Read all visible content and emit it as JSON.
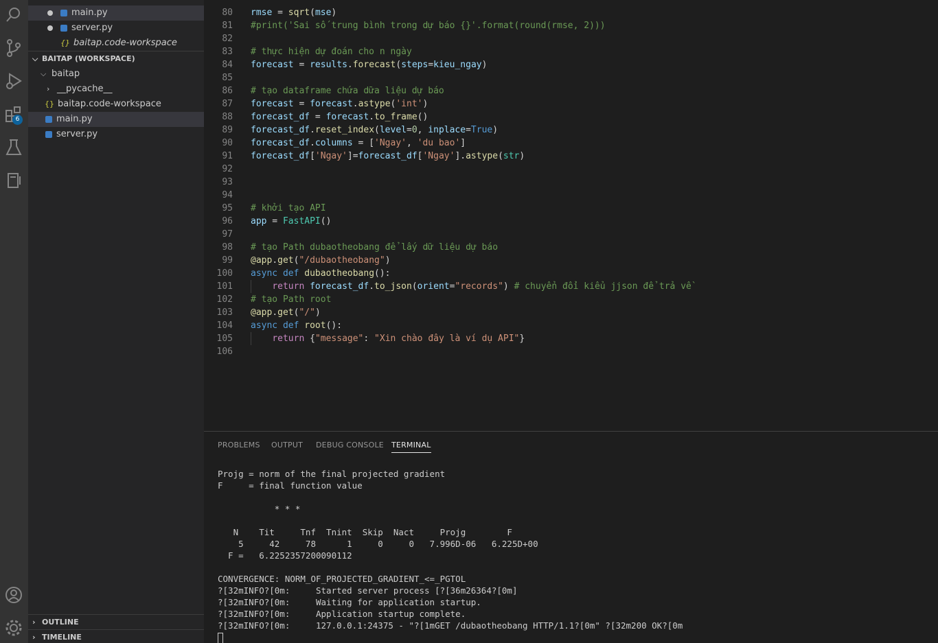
{
  "sidebar": {
    "open_editors": [
      {
        "label": "main.py",
        "type": "py"
      },
      {
        "label": "server.py",
        "type": "py"
      },
      {
        "label": "baitap.code-workspace",
        "type": "json"
      }
    ],
    "workspace_title": "BAITAP (WORKSPACE)",
    "tree": [
      {
        "label": "baitap",
        "type": "folder-open"
      },
      {
        "label": "__pycache__",
        "type": "folder"
      },
      {
        "label": "baitap.code-workspace",
        "type": "json"
      },
      {
        "label": "main.py",
        "type": "py"
      },
      {
        "label": "server.py",
        "type": "py"
      }
    ],
    "outline": "OUTLINE",
    "timeline": "TIMELINE"
  },
  "activity": {
    "extensions_badge": "6"
  },
  "editor": {
    "lines": [
      {
        "n": "80"
      },
      {
        "n": "81"
      },
      {
        "n": "82"
      },
      {
        "n": "83"
      },
      {
        "n": "84"
      },
      {
        "n": "85"
      },
      {
        "n": "86"
      },
      {
        "n": "87"
      },
      {
        "n": "88"
      },
      {
        "n": "89"
      },
      {
        "n": "90"
      },
      {
        "n": "91"
      },
      {
        "n": "92"
      },
      {
        "n": "93"
      },
      {
        "n": "94"
      },
      {
        "n": "95"
      },
      {
        "n": "96"
      },
      {
        "n": "97"
      },
      {
        "n": "98"
      },
      {
        "n": "99"
      },
      {
        "n": "100"
      },
      {
        "n": "101"
      },
      {
        "n": "102"
      },
      {
        "n": "103"
      },
      {
        "n": "104"
      },
      {
        "n": "105"
      },
      {
        "n": "106"
      }
    ],
    "code": {
      "l80": [
        "rmse",
        " = ",
        "sqrt",
        "(",
        "mse",
        ")"
      ],
      "l81": "#print('Sai số trung bình trong dự báo {}'.format(round(rmse, 2)))",
      "l83": "# thực hiện dự đoán cho n ngày",
      "l84": [
        "forecast",
        " = ",
        "results",
        ".",
        "forecast",
        "(",
        "steps",
        "=",
        "kieu_ngay",
        ")"
      ],
      "l86": "# tạo dataframe chứa dữa liệu dự báo",
      "l87": [
        "forecast",
        " = ",
        "forecast",
        ".",
        "astype",
        "(",
        "'int'",
        ")"
      ],
      "l88": [
        "forecast_df",
        " = ",
        "forecast",
        ".",
        "to_frame",
        "()"
      ],
      "l89": [
        "forecast_df",
        ".",
        "reset_index",
        "(",
        "level",
        "=",
        "0",
        ", ",
        "inplace",
        "=",
        "True",
        ")"
      ],
      "l90": [
        "forecast_df",
        ".",
        "columns",
        " = ",
        "[",
        "'Ngay'",
        ", ",
        "'du bao'",
        "]"
      ],
      "l91": [
        "forecast_df",
        "[",
        "'Ngay'",
        "]=",
        "forecast_df",
        "[",
        "'Ngay'",
        "].",
        "astype",
        "(",
        "str",
        ")"
      ],
      "l95": "# khởi tạo API",
      "l96": [
        "app",
        " = ",
        "FastAPI",
        "()"
      ],
      "l98": "# tạo Path dubaotheobang để lấy dữ liệu dự báo",
      "l99": [
        "@",
        "app",
        ".",
        "get",
        "(",
        "\"/dubaotheobang\"",
        ")"
      ],
      "l100": [
        "async",
        " ",
        "def",
        " ",
        "dubaotheobang",
        "():"
      ],
      "l101": [
        "    ",
        "return",
        " ",
        "forecast_df",
        ".",
        "to_json",
        "(",
        "orient",
        "=",
        "\"records\"",
        ") ",
        "# chuyển đổi kiểu jjson để trả về"
      ],
      "l102": "# tạo Path root",
      "l103": [
        "@",
        "app",
        ".",
        "get",
        "(",
        "\"/\"",
        ")"
      ],
      "l104": [
        "async",
        " ",
        "def",
        " ",
        "root",
        "():"
      ],
      "l105": [
        "    ",
        "return",
        " {",
        "\"message\"",
        ": ",
        "\"Xin chào đây là ví dụ API\"",
        "}"
      ]
    }
  },
  "panel": {
    "tabs": [
      "PROBLEMS",
      "OUTPUT",
      "DEBUG CONSOLE",
      "TERMINAL"
    ],
    "active_tab": "TERMINAL",
    "terminal_lines": [
      "Projg = norm of the final projected gradient",
      "F     = final function value",
      "",
      "           * * *",
      "",
      "   N    Tit     Tnf  Tnint  Skip  Nact     Projg        F",
      "    5     42     78      1     0     0   7.996D-06   6.225D+00",
      "  F =   6.2252357200090112",
      "",
      "CONVERGENCE: NORM_OF_PROJECTED_GRADIENT_<=_PGTOL",
      "?[32mINFO?[0m:     Started server process [?[36m26364?[0m]",
      "?[32mINFO?[0m:     Waiting for application startup.",
      "?[32mINFO?[0m:     Application startup complete.",
      "?[32mINFO?[0m:     127.0.0.1:24375 - \"?[1mGET /dubaotheobang HTTP/1.1?[0m\" ?[32m200 OK?[0m"
    ]
  }
}
